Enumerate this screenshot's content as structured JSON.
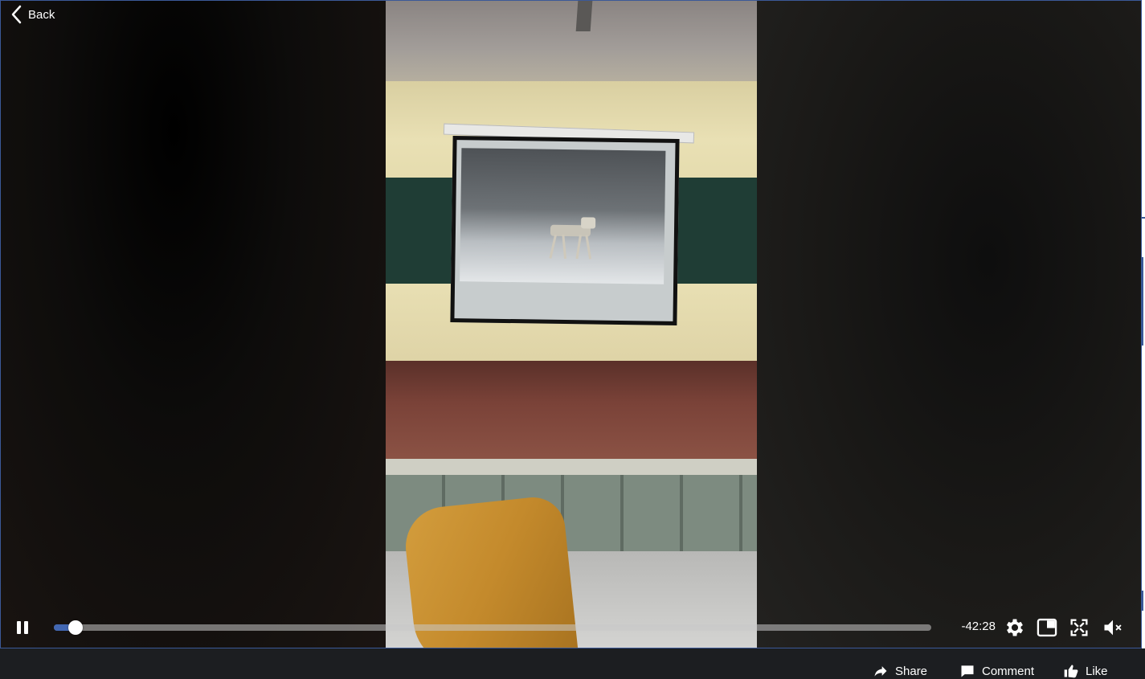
{
  "nav": {
    "back_label": "Back"
  },
  "player": {
    "time_remaining": "-42:28",
    "progress": 0.025,
    "muted": true,
    "accent_color": "#4267b2"
  },
  "icons": {
    "back": "chevron-left-icon",
    "pause": "pause-icon",
    "settings": "gear-icon",
    "pip": "picture-in-picture-icon",
    "fullscreen": "fullscreen-icon",
    "volume": "volume-muted-icon"
  },
  "actions": [
    {
      "label": "Share",
      "icon": "share-icon"
    },
    {
      "label": "Comment",
      "icon": "comment-icon"
    },
    {
      "label": "Like",
      "icon": "thumbs-up-icon"
    }
  ]
}
